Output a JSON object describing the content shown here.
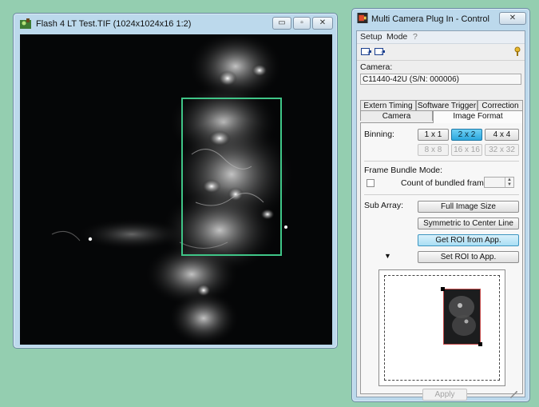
{
  "image_window": {
    "title": "Flash 4 LT Test.TIF (1024x1024x16 1:2)",
    "icon": "microscope-image-icon",
    "caption_buttons": {
      "minimize": "▭",
      "maximize": "▫",
      "close": "✕"
    }
  },
  "control_window": {
    "title": "Multi Camera Plug In - Control",
    "close_label": "✕",
    "menu": [
      "Setup",
      "Mode",
      "?"
    ],
    "toolbar_icons": [
      "camera-1-icon",
      "camera-2-icon",
      "help-key-icon"
    ],
    "camera_label": "Camera:",
    "camera_value": "C11440-42U (S/N: 000006)",
    "tabs_row1": [
      "Extern Timing",
      "Software Trigger",
      "Correction"
    ],
    "tabs_row2": [
      "Camera",
      "Image Format"
    ],
    "active_tab": "Image Format",
    "binning": {
      "label": "Binning:",
      "options": [
        "1 x 1",
        "2 x 2",
        "4 x 4",
        "8 x 8",
        "16 x 16",
        "32 x 32"
      ],
      "selected": "2 x 2"
    },
    "frame_bundle": {
      "label": "Frame Bundle Mode:",
      "count_label": "Count of bundled frames:",
      "count_value": ""
    },
    "sub_array": {
      "label": "Sub Array:",
      "buttons": [
        "Full Image Size",
        "Symmetric to Center Line",
        "Get ROI from App.",
        "Set ROI to App."
      ],
      "arrow": "▼"
    },
    "apply_label": "Apply",
    "edit_icon": "pencil-icon"
  },
  "colors": {
    "desktop": "#94ceb0",
    "roi_outline": "#3fc587",
    "selected_button": "#2ca7dd",
    "preview_roi_outline": "#c44b4b"
  }
}
